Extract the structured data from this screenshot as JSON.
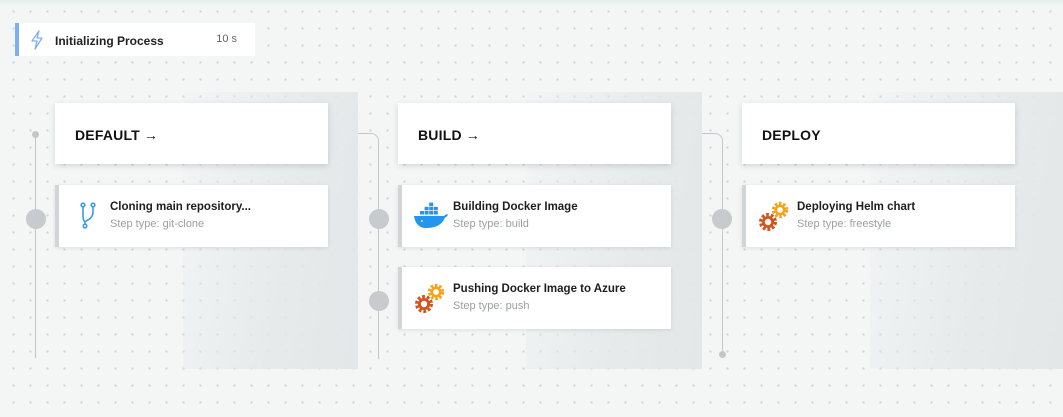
{
  "init": {
    "title": "Initializing Process",
    "duration": "10 s",
    "icon": "bolt-icon",
    "accent": "#7fb0ee"
  },
  "stages": [
    {
      "name": "DEFAULT",
      "arrow": "→",
      "steps": [
        {
          "name": "Cloning main repository...",
          "type": "Step type: git-clone",
          "icon": "git-branch-icon"
        }
      ]
    },
    {
      "name": "BUILD",
      "arrow": "→",
      "steps": [
        {
          "name": "Building Docker Image",
          "type": "Step type: build",
          "icon": "docker-icon"
        },
        {
          "name": "Pushing Docker Image to Azure",
          "type": "Step type: push",
          "icon": "gears-icon"
        }
      ]
    },
    {
      "name": "DEPLOY",
      "arrow": "",
      "steps": [
        {
          "name": "Deploying Helm chart",
          "type": "Step type: freestyle",
          "icon": "gears-icon"
        }
      ]
    }
  ],
  "colors": {
    "background": "#f4f6f6",
    "gear_orange": "#f5a31a",
    "gear_red": "#d4531c",
    "docker_blue": "#2496ed",
    "git_blue": "#3d9ddd"
  }
}
